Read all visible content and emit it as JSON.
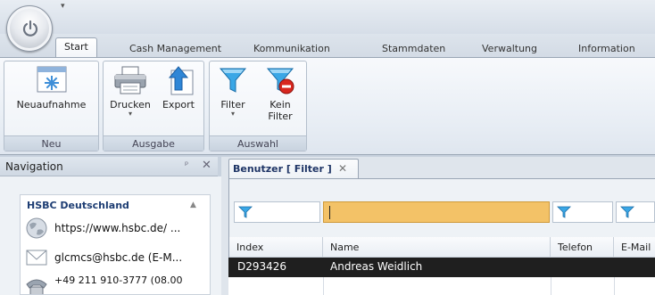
{
  "ribbon": {
    "tabs": [
      {
        "label": "Start",
        "active": true
      },
      {
        "label": "Cash Management"
      },
      {
        "label": "Kommunikation"
      },
      {
        "label": "Stammdaten"
      },
      {
        "label": "Verwaltung"
      },
      {
        "label": "Information"
      }
    ],
    "groups": {
      "neu": {
        "label": "Neu",
        "buttons": [
          {
            "label": "Neuaufnahme",
            "icon": "new-record-icon"
          }
        ]
      },
      "ausgabe": {
        "label": "Ausgabe",
        "buttons": [
          {
            "label": "Drucken",
            "icon": "printer-icon"
          },
          {
            "label": "Export",
            "icon": "export-icon"
          }
        ]
      },
      "auswahl": {
        "label": "Auswahl",
        "buttons": [
          {
            "label": "Filter",
            "icon": "filter-icon"
          },
          {
            "label": "Kein",
            "label2": "Filter",
            "icon": "remove-filter-icon"
          }
        ]
      }
    }
  },
  "navigation": {
    "title": "Navigation",
    "pin": "ᵖ",
    "close": "✕",
    "card": {
      "title": "HSBC Deutschland",
      "items": [
        {
          "icon": "globe-icon",
          "text": "https://www.hsbc.de/ ..."
        },
        {
          "icon": "mail-icon",
          "text": "glcmcs@hsbc.de (E-M..."
        },
        {
          "icon": "phone-icon",
          "text": "+49 211 910-3777 (08.00"
        }
      ]
    }
  },
  "document": {
    "tab": {
      "title": "Benutzer  [ Filter ]",
      "close": "✕"
    },
    "columns": [
      "Index",
      "Name",
      "Telefon",
      "E-Mail"
    ],
    "rows": [
      {
        "index": "D293426",
        "name": "Andreas Weidlich",
        "telefon": "",
        "email": ""
      }
    ]
  },
  "colors": {
    "active_filter": "#f3c267",
    "selected_row": "#1f1f1f",
    "header_title": "#1d3d73"
  }
}
